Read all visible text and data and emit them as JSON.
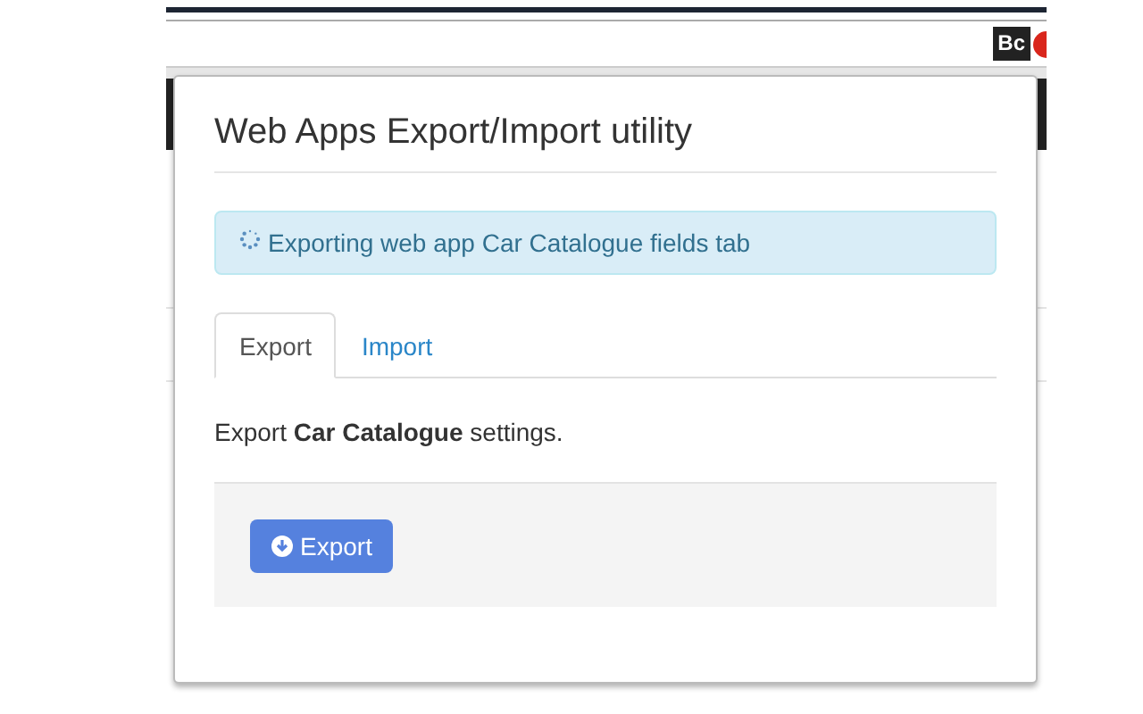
{
  "toolbar": {
    "extension_label": "Bc"
  },
  "popup": {
    "title": "Web Apps Export/Import utility",
    "alert": {
      "text": "Exporting web app Car Catalogue fields tab",
      "loading": true
    },
    "tabs": [
      {
        "label": "Export",
        "selected": true
      },
      {
        "label": "Import",
        "selected": false
      }
    ],
    "description": "Export **Car Catalogue** settings.",
    "button": "Export"
  }
}
